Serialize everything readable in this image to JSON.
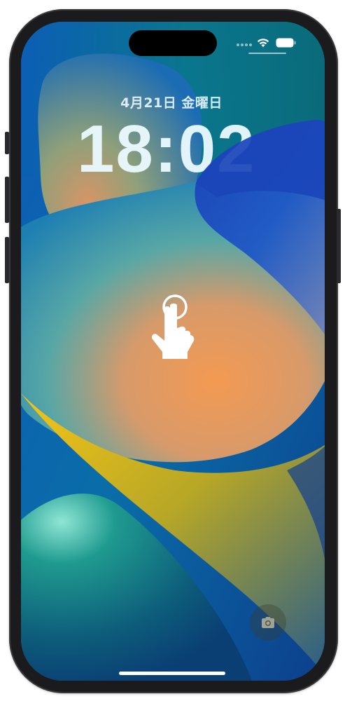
{
  "lock_screen": {
    "date": "4月21日 金曜日",
    "time": "18:02"
  },
  "status_bar": {
    "wifi": "wifi-icon",
    "battery": "battery-icon"
  },
  "icons": {
    "tap_gesture": "hand-tap-icon",
    "camera": "camera-icon"
  },
  "colors": {
    "frame": "#1b1b1d",
    "wallpaper_blue": "#0b5fb0",
    "wallpaper_orange": "#f2934e",
    "wallpaper_yellow": "#f2c31a",
    "wallpaper_teal": "#1a8a86"
  }
}
